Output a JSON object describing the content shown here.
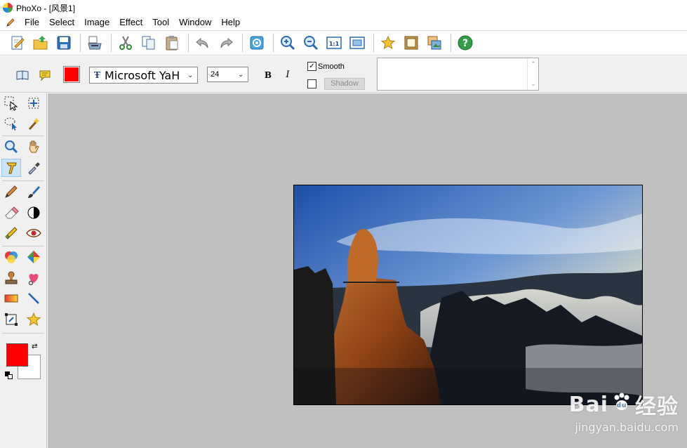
{
  "window": {
    "title": "PhoXo - [风景1]"
  },
  "menu": {
    "items": [
      "File",
      "Select",
      "Image",
      "Effect",
      "Tool",
      "Window",
      "Help"
    ]
  },
  "toolbar": {
    "buttons": [
      "new-icon",
      "open-icon",
      "save-icon",
      "scan-icon",
      "cut-icon",
      "copy-icon",
      "paste-icon",
      "undo-icon",
      "redo-icon",
      "refresh-icon",
      "zoom-in-icon",
      "zoom-out-icon",
      "actual-size-icon",
      "fit-window-icon",
      "favorite-icon",
      "frame-icon",
      "layers-icon",
      "help-icon"
    ]
  },
  "text_tool": {
    "color": "#ff0000",
    "font": "Microsoft YaH",
    "size": "24",
    "bold_label": "B",
    "italic_label": "I",
    "smooth_label": "Smooth",
    "smooth_checked": true,
    "shadow_label": "Shadow",
    "shadow_checked": false,
    "text_value": ""
  },
  "tools": {
    "active": "text-tool",
    "foreground_color": "#ff0000",
    "background_color": "#ffffff"
  },
  "canvas": {
    "background": "#c0c0c0",
    "image": "mountain-landscape-photo"
  },
  "watermark": {
    "logo_text_1": "Bai",
    "logo_text_2": "经验",
    "url": "jingyan.baidu.com"
  }
}
